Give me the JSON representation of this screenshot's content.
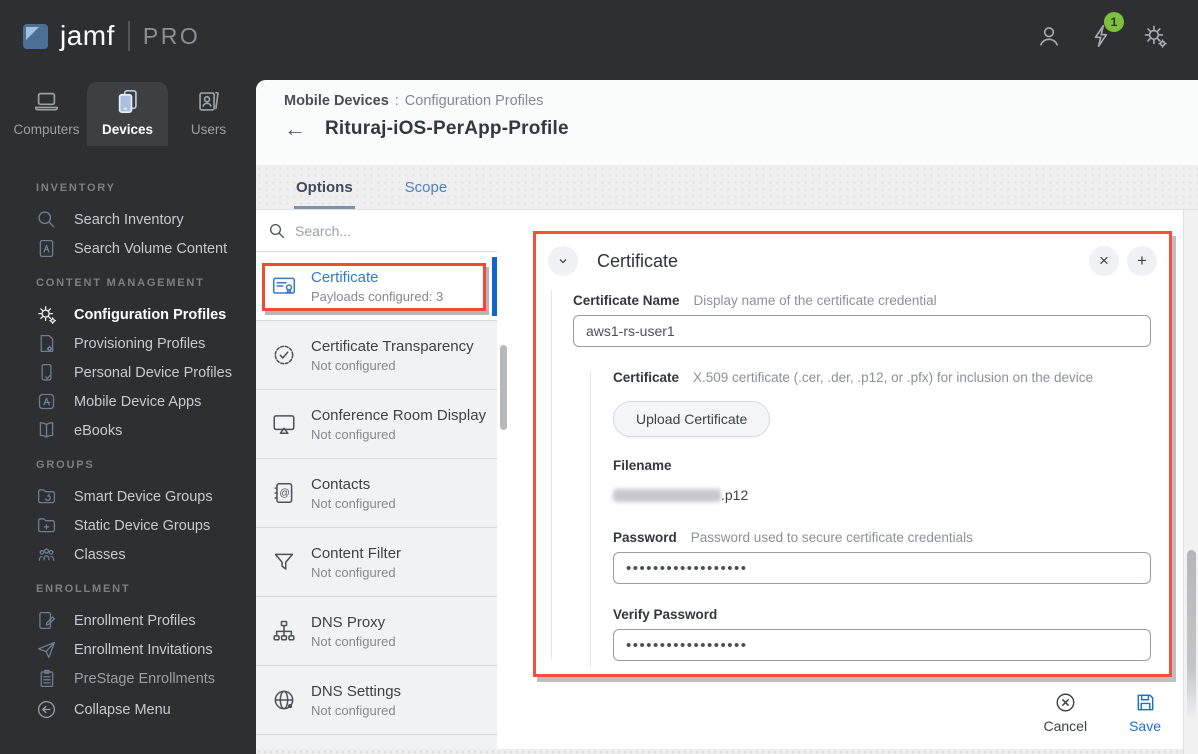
{
  "topbar": {
    "brand_name": "jamf",
    "brand_suffix": "PRO",
    "notification_count": "1"
  },
  "nav_tabs": [
    {
      "label": "Computers",
      "icon": "laptop-icon",
      "active": false
    },
    {
      "label": "Devices",
      "icon": "mobile-devices-icon",
      "active": true
    },
    {
      "label": "Users",
      "icon": "users-badge-icon",
      "active": false
    }
  ],
  "sidebar": {
    "sections": [
      {
        "header": "INVENTORY",
        "items": [
          {
            "label": "Search Inventory",
            "icon": "search-icon"
          },
          {
            "label": "Search Volume Content",
            "icon": "volume-content-icon"
          }
        ]
      },
      {
        "header": "CONTENT MANAGEMENT",
        "items": [
          {
            "label": "Configuration Profiles",
            "icon": "gears-icon",
            "active": true
          },
          {
            "label": "Provisioning Profiles",
            "icon": "document-gear-icon"
          },
          {
            "label": "Personal Device Profiles",
            "icon": "phone-check-icon"
          },
          {
            "label": "Mobile Device Apps",
            "icon": "app-store-icon"
          },
          {
            "label": "eBooks",
            "icon": "open-book-icon"
          }
        ]
      },
      {
        "header": "GROUPS",
        "items": [
          {
            "label": "Smart Device Groups",
            "icon": "folder-sync-icon"
          },
          {
            "label": "Static Device Groups",
            "icon": "folder-plus-icon"
          },
          {
            "label": "Classes",
            "icon": "people-icon"
          }
        ]
      },
      {
        "header": "ENROLLMENT",
        "items": [
          {
            "label": "Enrollment Profiles",
            "icon": "tablet-pencil-icon"
          },
          {
            "label": "Enrollment Invitations",
            "icon": "paper-plane-icon"
          },
          {
            "label": "PreStage Enrollments",
            "icon": "clipboard-icon"
          }
        ]
      }
    ],
    "collapse_label": "Collapse Menu"
  },
  "header": {
    "breadcrumb_parent": "Mobile Devices",
    "breadcrumb_separator": ":",
    "breadcrumb_current": "Configuration Profiles",
    "back_arrow": "←",
    "title": "Rituraj-iOS-PerApp-Profile"
  },
  "tabs": [
    {
      "label": "Options",
      "active": true
    },
    {
      "label": "Scope",
      "active": false
    }
  ],
  "payloads": {
    "search_placeholder": "Search...",
    "items": [
      {
        "title": "Certificate",
        "subtitle": "Payloads configured: 3",
        "icon": "certificate-icon",
        "selected": true,
        "annotated": true
      },
      {
        "title": "Certificate Transparency",
        "subtitle": "Not configured",
        "icon": "seal-check-icon"
      },
      {
        "title": "Conference Room Display",
        "subtitle": "Not configured",
        "icon": "display-icon"
      },
      {
        "title": "Contacts",
        "subtitle": "Not configured",
        "icon": "contacts-book-icon"
      },
      {
        "title": "Content Filter",
        "subtitle": "Not configured",
        "icon": "funnel-icon"
      },
      {
        "title": "DNS Proxy",
        "subtitle": "Not configured",
        "icon": "network-icon"
      },
      {
        "title": "DNS Settings",
        "subtitle": "Not configured",
        "icon": "globe-icon"
      }
    ]
  },
  "panel": {
    "title": "Certificate",
    "close_glyph": "×",
    "add_glyph": "+",
    "fields": {
      "certificate_name": {
        "label": "Certificate Name",
        "help": "Display name of the certificate credential",
        "value": "aws1-rs-user1"
      },
      "certificate_file": {
        "label": "Certificate",
        "help": "X.509 certificate (.cer, .der, .p12, or .pfx) for inclusion on the device",
        "upload_label": "Upload Certificate",
        "filename_label": "Filename",
        "filename_redacted": true,
        "filename_extension": ".p12"
      },
      "password": {
        "label": "Password",
        "help": "Password used to secure certificate credentials",
        "value_masked": "••••••••••••••••••"
      },
      "verify_password": {
        "label": "Verify Password",
        "value_masked": "••••••••••••••••••"
      }
    }
  },
  "footer": {
    "cancel_label": "Cancel",
    "save_label": "Save"
  },
  "colors": {
    "accent_blue": "#1a6fd4",
    "link_blue": "#2f7bc9",
    "annotation_red": "#ee4b35",
    "badge_green": "#7dbf41",
    "dark_chrome": "#2d2f30"
  }
}
